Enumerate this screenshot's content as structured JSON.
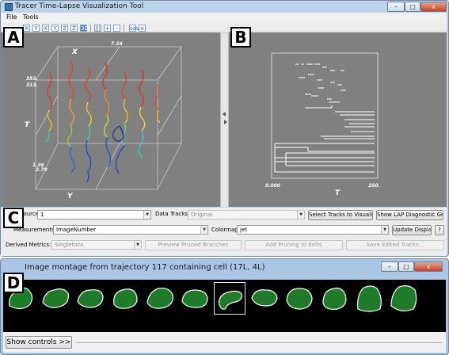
{
  "window": {
    "title": "Tracer Time-Lapse Visualization Tool",
    "min": "–",
    "max": "□",
    "close": "x"
  },
  "menu": [
    "File",
    "Tools"
  ],
  "toolbar_icons": [
    "X",
    "Y",
    "X",
    "Y",
    "Z",
    "Z",
    "3D",
    "|||",
    "+",
    "-",
    "save",
    "o"
  ],
  "labels": {
    "a": "A",
    "b": "B",
    "c": "C",
    "d": "D"
  },
  "plot3d": {
    "axis_x": "X",
    "axis_y": "Y",
    "axis_t": "T",
    "tick_top": "7.54",
    "tick_left_top": "353.",
    "tick_left_mid": "313.",
    "tick_left_bot1": "1.36",
    "tick_left_bot2": "2.79"
  },
  "plot2d": {
    "x_min": "0.000",
    "x_max": "250.",
    "x_label": "T"
  },
  "controls": {
    "source_label": "Source:",
    "source_value": "1",
    "data_tracks_label": "Data Tracks:",
    "data_tracks_value": "Original",
    "select_tracks_btn": "Select Tracks to Visualize...",
    "lap_btn": "Show LAP Diagnostic Graphs",
    "measurements_label": "Measurements:",
    "measurements_value": "ImageNumber",
    "colormap_label": "Colormap:",
    "colormap_value": "jet",
    "update_btn": "Update Display",
    "help_btn": "?",
    "derived_label": "Derived Metrics:",
    "derived_value": "Singletons",
    "preview_btn": "Preview Pruned Branches",
    "add_pruning_btn": "Add Pruning to Edits",
    "save_edited_btn": "Save Edited Tracks..."
  },
  "montage": {
    "title": "Image montage from trajectory 117 containing cell (17L, 4L)",
    "min": "–",
    "max": "□",
    "close": "x",
    "show_controls_btn": "Show controls >>",
    "selected_index": 6
  },
  "colors": {
    "plot_bg": "#808080",
    "window_frame": "#bcd3ea",
    "cell_green": "#1f7a2a"
  }
}
